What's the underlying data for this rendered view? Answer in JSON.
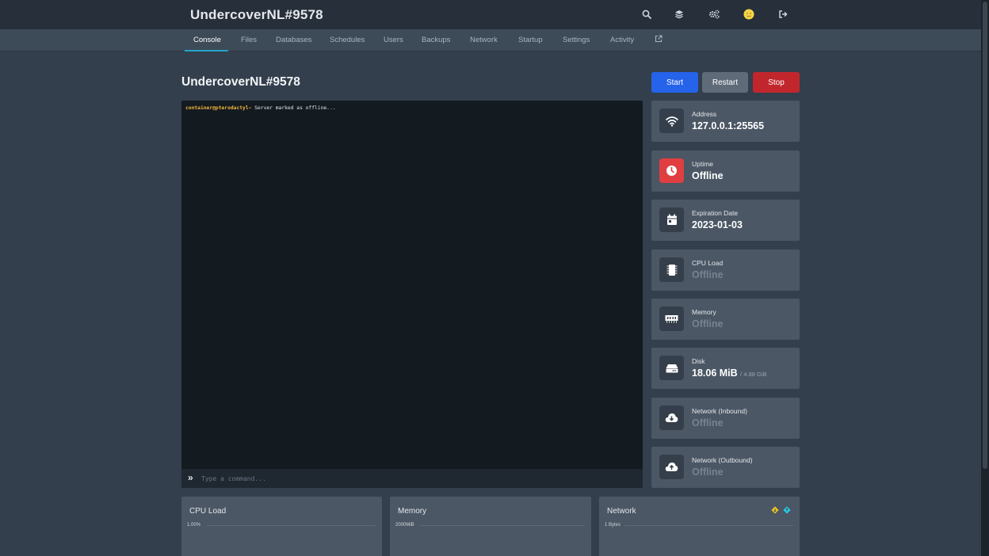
{
  "app": {
    "title": "UndercoverNL#9578"
  },
  "topbar_icons": [
    "search-icon",
    "layers-icon",
    "cogs-icon",
    "avatar",
    "sign-out-icon"
  ],
  "tabs": [
    {
      "label": "Console",
      "active": true
    },
    {
      "label": "Files"
    },
    {
      "label": "Databases"
    },
    {
      "label": "Schedules"
    },
    {
      "label": "Users"
    },
    {
      "label": "Backups"
    },
    {
      "label": "Network"
    },
    {
      "label": "Startup"
    },
    {
      "label": "Settings"
    },
    {
      "label": "Activity"
    }
  ],
  "page": {
    "title": "UndercoverNL#9578"
  },
  "power": {
    "start": "Start",
    "restart": "Restart",
    "stop": "Stop"
  },
  "console": {
    "prompt": "container@pterodactyl~",
    "message": " Server marked as offline...",
    "chevron": "»",
    "placeholder": "Type a command..."
  },
  "stats": [
    {
      "label": "Address",
      "value": "127.0.0.1:25565",
      "icon": "wifi-icon"
    },
    {
      "label": "Uptime",
      "value": "Offline",
      "icon": "clock-icon"
    },
    {
      "label": "Expiration Date",
      "value": "2023-01-03",
      "icon": "calendar-icon"
    },
    {
      "label": "CPU Load",
      "value": "Offline",
      "icon": "microchip-icon"
    },
    {
      "label": "Memory",
      "value": "Offline",
      "icon": "memory-icon"
    },
    {
      "label": "Disk",
      "value": "18.06 MiB",
      "suffix": "/ 4.88 GiB",
      "icon": "hdd-icon"
    },
    {
      "label": "Network (Inbound)",
      "value": "Offline",
      "icon": "cloud-download-icon"
    },
    {
      "label": "Network (Outbound)",
      "value": "Offline",
      "icon": "cloud-upload-icon"
    }
  ],
  "graphs": [
    {
      "title": "CPU Load",
      "axis_label": "1.00%"
    },
    {
      "title": "Memory",
      "axis_label": "2000MiB"
    },
    {
      "title": "Network",
      "axis_label": "1 Bytes"
    }
  ],
  "colors": {
    "accent": "#22a5c8",
    "start": "#2563eb",
    "restart": "#5f6b79",
    "stop": "#c2262d",
    "uptime_offline": "#e03e40",
    "prompt": "#f4b73c",
    "inbound_legend": "#facc15",
    "outbound_legend": "#22d3ee"
  }
}
